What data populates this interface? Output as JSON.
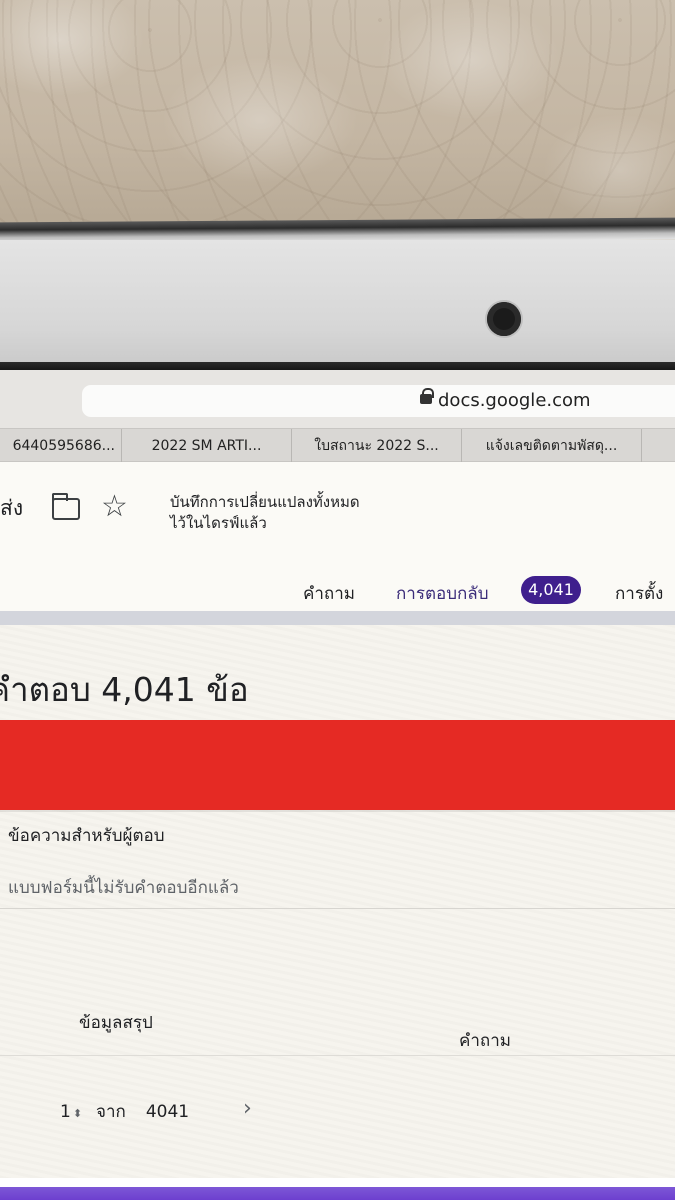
{
  "browser": {
    "url": "docs.google.com",
    "tabs": [
      "6440595686...",
      "2022 SM ARTI...",
      "ใบสถานะ 2022 S...",
      "แจ้งเลขติดตามพัสดุ...",
      ""
    ]
  },
  "docs_header": {
    "send_label": "ส่ง",
    "save_status_line1": "บันทึกการเปลี่ยนแปลงทั้งหมด",
    "save_status_line2": "ไว้ในไดรฟ์แล้ว",
    "nav": {
      "questions": "คำถาม",
      "responses": "การตอบกลับ",
      "response_count": "4,041",
      "settings": "การตั้ง"
    }
  },
  "content": {
    "summary_title": "คำตอบ 4,041 ข้อ",
    "banner_color": "#e52a24",
    "message_label": "ข้อความสำหรับผู้ตอบ",
    "message_value": "แบบฟอร์มนี้ไม่รับคำตอบอีกแล้ว",
    "view_tabs": {
      "summary": "ข้อมูลสรุป",
      "question": "คำถาม"
    },
    "pager": {
      "current": "1",
      "of_label": "จาก",
      "total": "4041"
    }
  },
  "colors": {
    "accent": "#4b2ba0",
    "badge": "#3f1f8d"
  }
}
